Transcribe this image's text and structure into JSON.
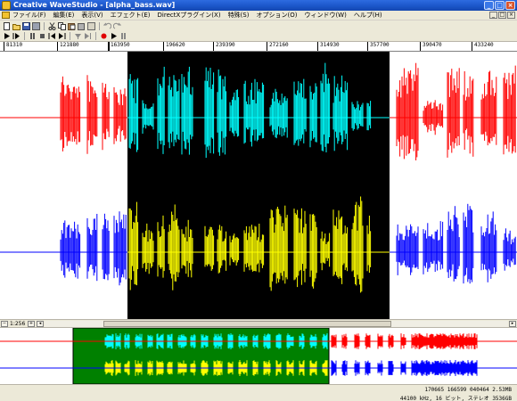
{
  "window": {
    "title": "Creative WaveStudio - [alpha_bass.wav]",
    "buttons": {
      "minimize": "_",
      "maximize": "□",
      "close": "×"
    }
  },
  "menu": {
    "items": [
      "ファイル(F)",
      "編集(E)",
      "表示(V)",
      "エフェクト(E)",
      "DirectXプラグイン(X)",
      "特殊(S)",
      "オプション(O)",
      "ウィンドウ(W)",
      "ヘルプ(H)"
    ]
  },
  "toolbar": {
    "row1_icons": [
      "new-file",
      "open-file",
      "save-file",
      "save-all",
      "cut",
      "copy",
      "paste",
      "paste-mix",
      "properties",
      "undo",
      "redo"
    ],
    "row2_icons": [
      "play",
      "play-from-cursor",
      "pause",
      "stop",
      "rewind",
      "fast-forward",
      "record-filter",
      "go-end",
      "record",
      "play-loop",
      "pause-record"
    ]
  },
  "ruler": {
    "labels": [
      "81310",
      "121880",
      "163950",
      "196620",
      "239390",
      "272160",
      "314930",
      "357700",
      "390470",
      "433240"
    ]
  },
  "scrollbar": {
    "zoom_label": "1:256"
  },
  "waveform": {
    "selected_channel_colors": [
      "#00ffff",
      "#ffff00"
    ],
    "channel_colors": [
      "#ff0000",
      "#0000ff"
    ],
    "selection_background": "#000000",
    "overview_selection_background": "#008000"
  },
  "status": {
    "line1": "170665   166599   040464   2.53MB",
    "line2": "44100 kHz, 16 ビット, ステレオ  3536GB"
  }
}
